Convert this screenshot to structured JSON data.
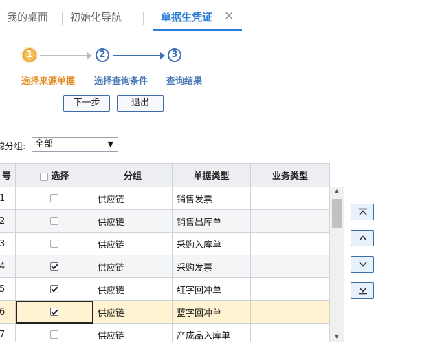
{
  "tabs": [
    {
      "label": "我的桌面"
    },
    {
      "label": "初始化导航"
    },
    {
      "label": "单据生凭证",
      "close": "×"
    }
  ],
  "stepper": {
    "steps": [
      {
        "num": "1",
        "label": "选择来源单据"
      },
      {
        "num": "2",
        "label": "选择查询条件"
      },
      {
        "num": "3",
        "label": "查询结果"
      }
    ]
  },
  "buttons": {
    "next": "下一步",
    "exit": "退出"
  },
  "filter": {
    "label": "滤分组:",
    "value": "全部"
  },
  "table": {
    "headers": {
      "num": "号",
      "select": "选择",
      "group": "分组",
      "doc_type": "单据类型",
      "biz_type": "业务类型"
    },
    "rows": [
      {
        "num": "1",
        "checked": false,
        "group": "供应链",
        "doc_type": "销售发票",
        "biz_type": ""
      },
      {
        "num": "2",
        "checked": false,
        "group": "供应链",
        "doc_type": "销售出库单",
        "biz_type": ""
      },
      {
        "num": "3",
        "checked": false,
        "group": "供应链",
        "doc_type": "采购入库单",
        "biz_type": ""
      },
      {
        "num": "4",
        "checked": true,
        "group": "供应链",
        "doc_type": "采购发票",
        "biz_type": ""
      },
      {
        "num": "5",
        "checked": true,
        "group": "供应链",
        "doc_type": "红字回冲单",
        "biz_type": ""
      },
      {
        "num": "6",
        "checked": true,
        "group": "供应链",
        "doc_type": "蓝字回冲单",
        "biz_type": ""
      },
      {
        "num": "7",
        "checked": false,
        "group": "供应链",
        "doc_type": "产成品入库单",
        "biz_type": ""
      }
    ],
    "selected_row": 5
  },
  "move_buttons": [
    "move-top-icon",
    "move-up-icon",
    "move-down-icon",
    "move-bottom-icon"
  ],
  "colors": {
    "accent": "#2a7dd6",
    "step_done": "#e08b1f",
    "step_todo": "#4a78b8",
    "selected_row": "#fff3d1"
  }
}
